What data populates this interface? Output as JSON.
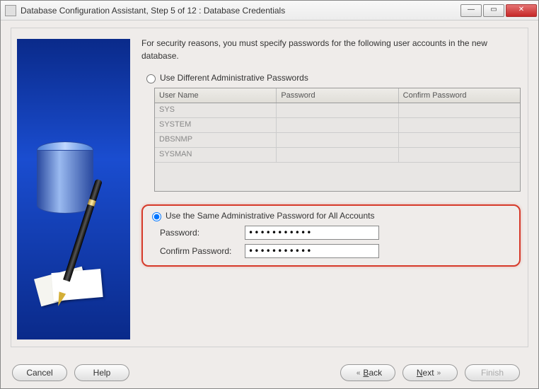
{
  "window": {
    "title": "Database Configuration Assistant, Step 5 of 12 : Database Credentials"
  },
  "intro": "For security reasons, you must specify passwords for the following user accounts in the new database.",
  "option_different": {
    "label": "Use Different Administrative Passwords",
    "selected": false
  },
  "cred_table": {
    "headers": {
      "user": "User Name",
      "pwd": "Password",
      "cpwd": "Confirm Password"
    },
    "rows": [
      {
        "user": "SYS",
        "pwd": "",
        "cpwd": ""
      },
      {
        "user": "SYSTEM",
        "pwd": "",
        "cpwd": ""
      },
      {
        "user": "DBSNMP",
        "pwd": "",
        "cpwd": ""
      },
      {
        "user": "SYSMAN",
        "pwd": "",
        "cpwd": ""
      }
    ]
  },
  "option_same": {
    "label": "Use the Same Administrative Password for All Accounts",
    "selected": true,
    "password_label": "Password:",
    "confirm_label": "Confirm Password:",
    "password_value": "***********",
    "confirm_value": "***********"
  },
  "buttons": {
    "cancel": "Cancel",
    "help": "Help",
    "back": "Back",
    "next": "Next",
    "finish": "Finish"
  }
}
